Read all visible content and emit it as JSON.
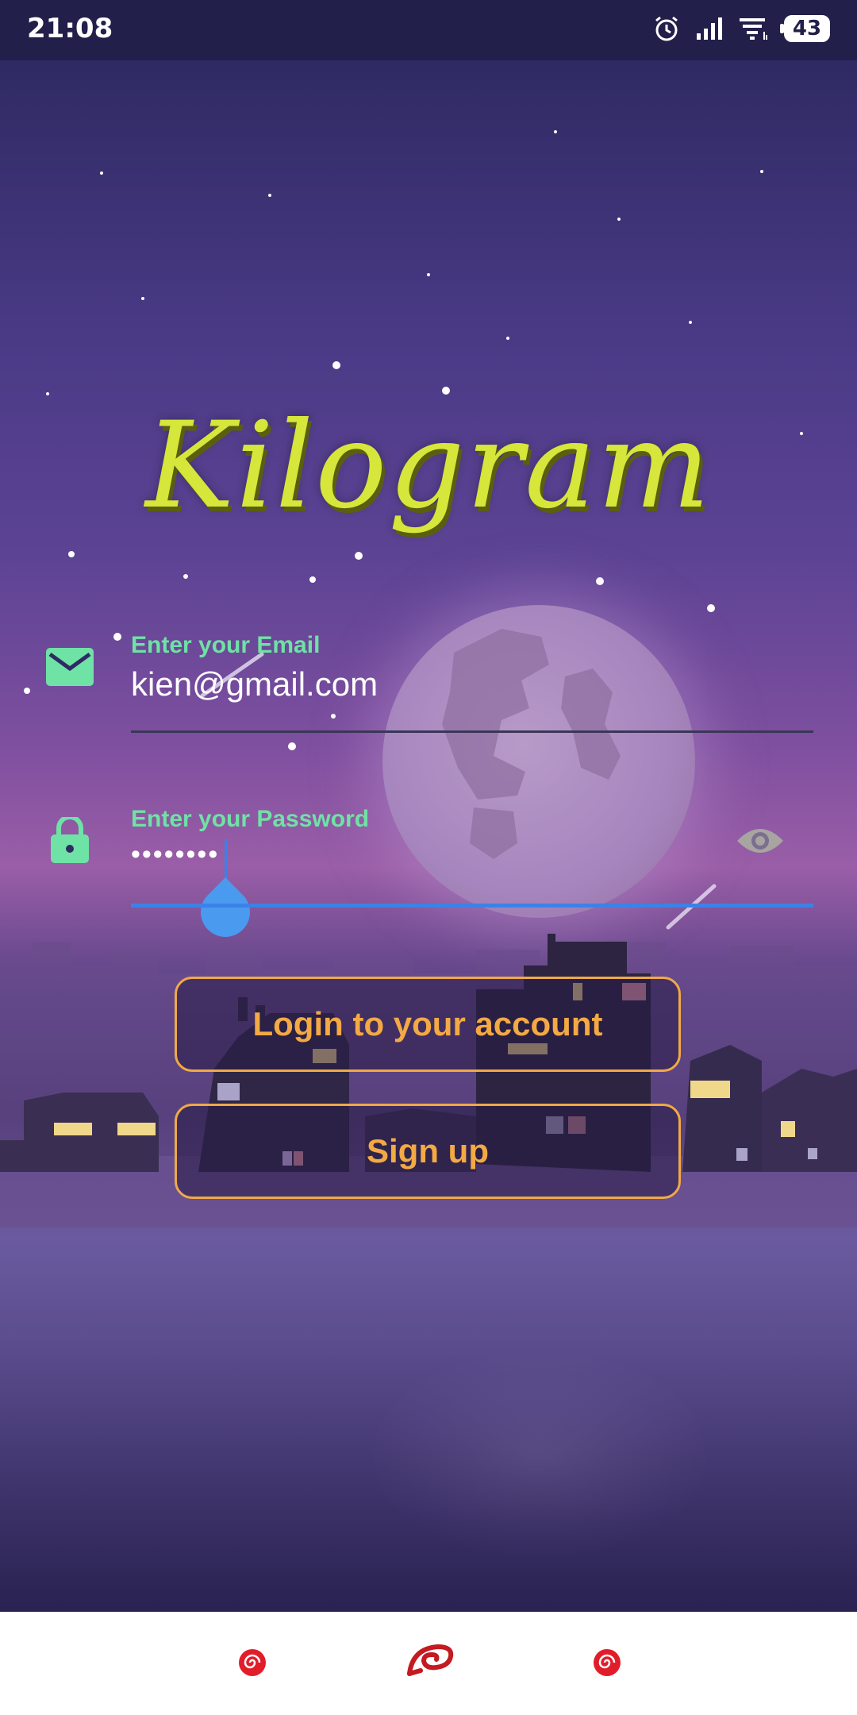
{
  "status_bar": {
    "time": "21:08",
    "battery": "43"
  },
  "app": {
    "title": "Kilogram"
  },
  "email": {
    "label": "Enter your Email",
    "value": "kien@gmail.com"
  },
  "password": {
    "label": "Enter your Password",
    "value": "••••••••"
  },
  "buttons": {
    "login": "Login to your account",
    "signup": "Sign up"
  },
  "colors": {
    "accent_green": "#6fe2a5",
    "button_orange": "#f3a944",
    "focus_blue": "#3b82e8",
    "logo_yellow": "#d6e63a"
  },
  "icons": {
    "email": "mail-icon",
    "password": "lock-icon",
    "toggle": "eye-icon",
    "nav": [
      "spiral-icon",
      "leaf-headband-icon",
      "spiral-icon"
    ]
  }
}
